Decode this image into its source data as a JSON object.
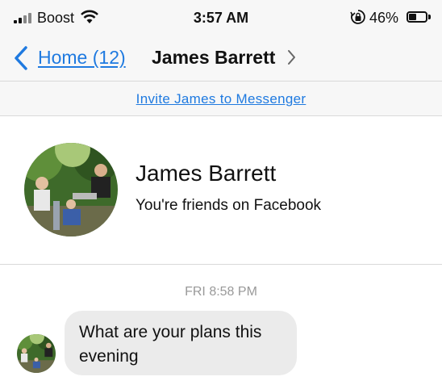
{
  "status_bar": {
    "carrier": "Boost",
    "time": "3:57 AM",
    "battery_percent": "46%",
    "battery_level": 0.46
  },
  "nav": {
    "back_label": "Home (12)",
    "title": "James Barrett"
  },
  "invite": {
    "link_text": "Invite James to Messenger"
  },
  "profile": {
    "name": "James Barrett",
    "subtitle": "You're friends on Facebook"
  },
  "messages": {
    "timestamp": "FRI 8:58 PM",
    "items": [
      {
        "text": "What are your plans this evening"
      }
    ]
  },
  "colors": {
    "link": "#1f7ae0",
    "bar_background": "#f7f7f7",
    "bubble": "#ebebeb",
    "timestamp": "#999999"
  }
}
